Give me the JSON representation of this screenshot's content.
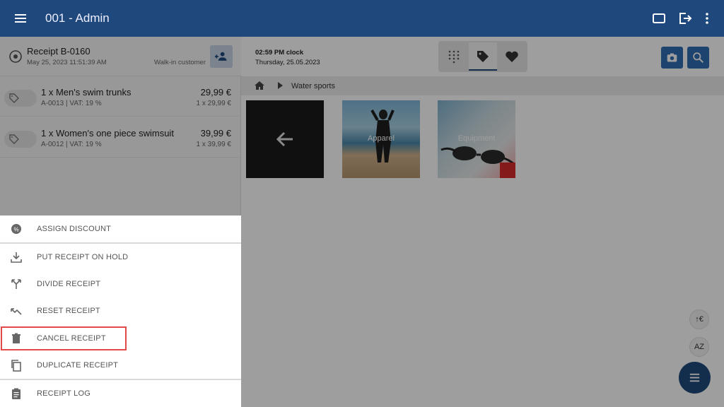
{
  "header": {
    "title": "001 - Admin",
    "color": "#1f497d",
    "icons": [
      "menu-icon",
      "tablet-icon",
      "logout-icon",
      "more-vert-icon"
    ]
  },
  "receipt": {
    "title": "Receipt B-0160",
    "datetime": "May 25, 2023 11:51:39 AM",
    "customer": "Walk-in customer",
    "lines": [
      {
        "name": "1 x Men's swim trunks",
        "meta": "A-0013 | VAT: 19 %",
        "price": "29,99 €",
        "qty": "1 x 29,99 €"
      },
      {
        "name": "1 x Women's one piece swimsuit",
        "meta": "A-0012 | VAT: 19 %",
        "price": "39,99 €",
        "qty": "1 x 39,99 €"
      }
    ]
  },
  "clock": {
    "time": "02:59 PM clock",
    "date": "Thursday,  25.05.2023"
  },
  "breadcrumb": {
    "category": "Water sports"
  },
  "tiles": [
    {
      "label": ""
    },
    {
      "label": "Apparel"
    },
    {
      "label": "Equipment"
    }
  ],
  "side_buttons": {
    "price_sort": "↑€",
    "alpha_sort": "AZ"
  },
  "menu": {
    "items": [
      {
        "label": "ASSIGN DISCOUNT",
        "icon": "discount-icon"
      },
      {
        "label": "PUT RECEIPT ON HOLD",
        "icon": "download-icon"
      },
      {
        "label": "DIVIDE RECEIPT",
        "icon": "split-icon"
      },
      {
        "label": "RESET RECEIPT",
        "icon": "reset-icon"
      },
      {
        "label": "CANCEL RECEIPT",
        "icon": "trash-icon"
      },
      {
        "label": "DUPLICATE RECEIPT",
        "icon": "copy-icon"
      },
      {
        "label": "RECEIPT LOG",
        "icon": "clipboard-icon"
      }
    ],
    "highlight_color": "#e24a4a"
  }
}
